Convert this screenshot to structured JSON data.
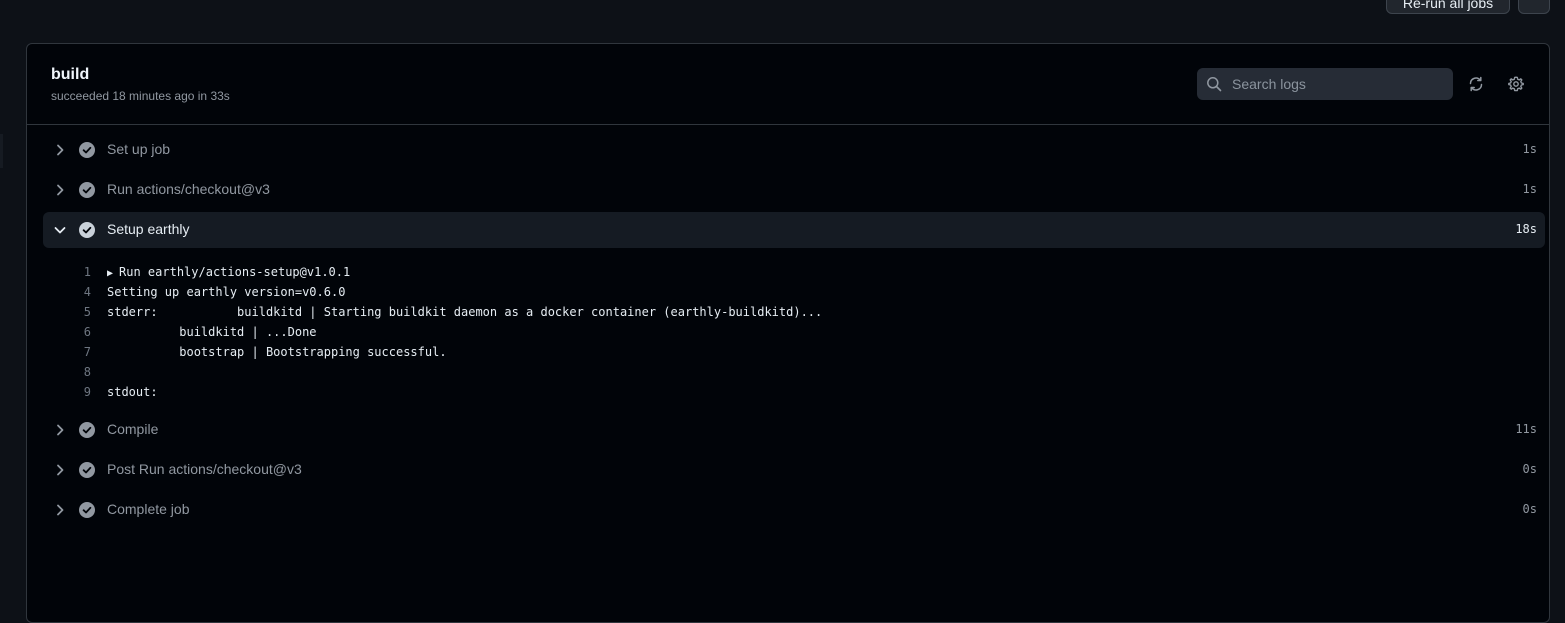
{
  "top_actions": {
    "rerun_label": "Re-run all jobs",
    "more_label": ""
  },
  "job": {
    "title": "build",
    "status": "succeeded 18 minutes ago in 33s"
  },
  "search": {
    "placeholder": "Search logs"
  },
  "icons": {
    "search": "search-icon",
    "refresh": "refresh-icon",
    "settings": "gear-icon",
    "chevron": "chevron-icon",
    "check": "check-circle-icon"
  },
  "steps": [
    {
      "label": "Set up job",
      "duration": "1s",
      "expanded": false
    },
    {
      "label": "Run actions/checkout@v3",
      "duration": "1s",
      "expanded": false
    },
    {
      "label": "Setup earthly",
      "duration": "18s",
      "expanded": true
    },
    {
      "label": "Compile",
      "duration": "11s",
      "expanded": false
    },
    {
      "label": "Post Run actions/checkout@v3",
      "duration": "0s",
      "expanded": false
    },
    {
      "label": "Complete job",
      "duration": "0s",
      "expanded": false
    }
  ],
  "log": [
    {
      "num": "1",
      "text": "Run earthly/actions-setup@v1.0.1",
      "group": true
    },
    {
      "num": "4",
      "text": "Setting up earthly version=v0.6.0"
    },
    {
      "num": "5",
      "text": "stderr:           buildkitd | Starting buildkit daemon as a docker container (earthly-buildkitd)..."
    },
    {
      "num": "6",
      "text": "          buildkitd | ...Done"
    },
    {
      "num": "7",
      "text": "          bootstrap | Bootstrapping successful."
    },
    {
      "num": "8",
      "text": ""
    },
    {
      "num": "9",
      "text": "stdout:"
    }
  ],
  "colors": {
    "background": "#0d1117",
    "panel": "#010409",
    "border": "#30363d",
    "check": "#9198a1"
  }
}
